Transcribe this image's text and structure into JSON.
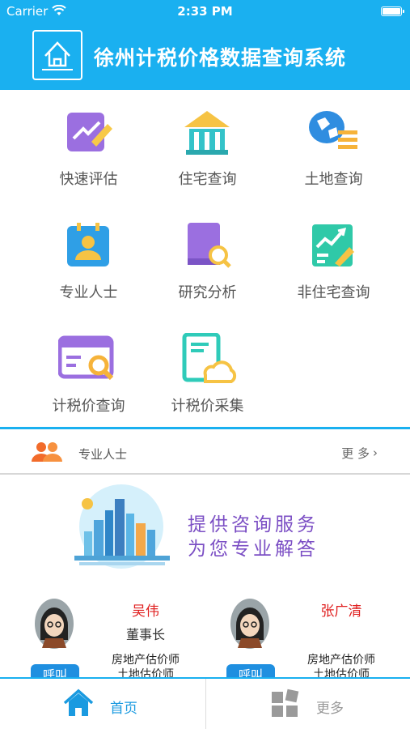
{
  "status": {
    "carrier": "Carrier",
    "time": "2:33 PM"
  },
  "header": {
    "title": "徐州计税价格数据查询系统"
  },
  "grid": [
    {
      "label": "快速评估",
      "icon": "pencil-icon"
    },
    {
      "label": "住宅查询",
      "icon": "house-icon"
    },
    {
      "label": "土地查询",
      "icon": "land-icon"
    },
    {
      "label": "专业人士",
      "icon": "professional-icon"
    },
    {
      "label": "研究分析",
      "icon": "research-icon"
    },
    {
      "label": "非住宅查询",
      "icon": "chart-icon"
    },
    {
      "label": "计税价查询",
      "icon": "tax-search-icon"
    },
    {
      "label": "计税价采集",
      "icon": "tax-collect-icon"
    }
  ],
  "section": {
    "title": "专业人士",
    "more": "更 多"
  },
  "banner": {
    "line1": "提供咨询服务",
    "line2": "为您专业解答"
  },
  "persons": [
    {
      "name": "吴伟",
      "role": "董事长",
      "q1": "房地产估价师",
      "q2": "土地估价师",
      "call": "呼叫"
    },
    {
      "name": "张广清",
      "role": "",
      "q1": "房地产估价师",
      "q2": "土地估价师",
      "call": "呼叫"
    }
  ],
  "tabs": {
    "home": "首页",
    "more": "更多"
  },
  "colors": {
    "header": "#1ab0f0",
    "accent_red": "#e02020",
    "slogan": "#7b4ec4",
    "tab_active": "#1a9ae0",
    "tab_inactive": "#999999"
  }
}
